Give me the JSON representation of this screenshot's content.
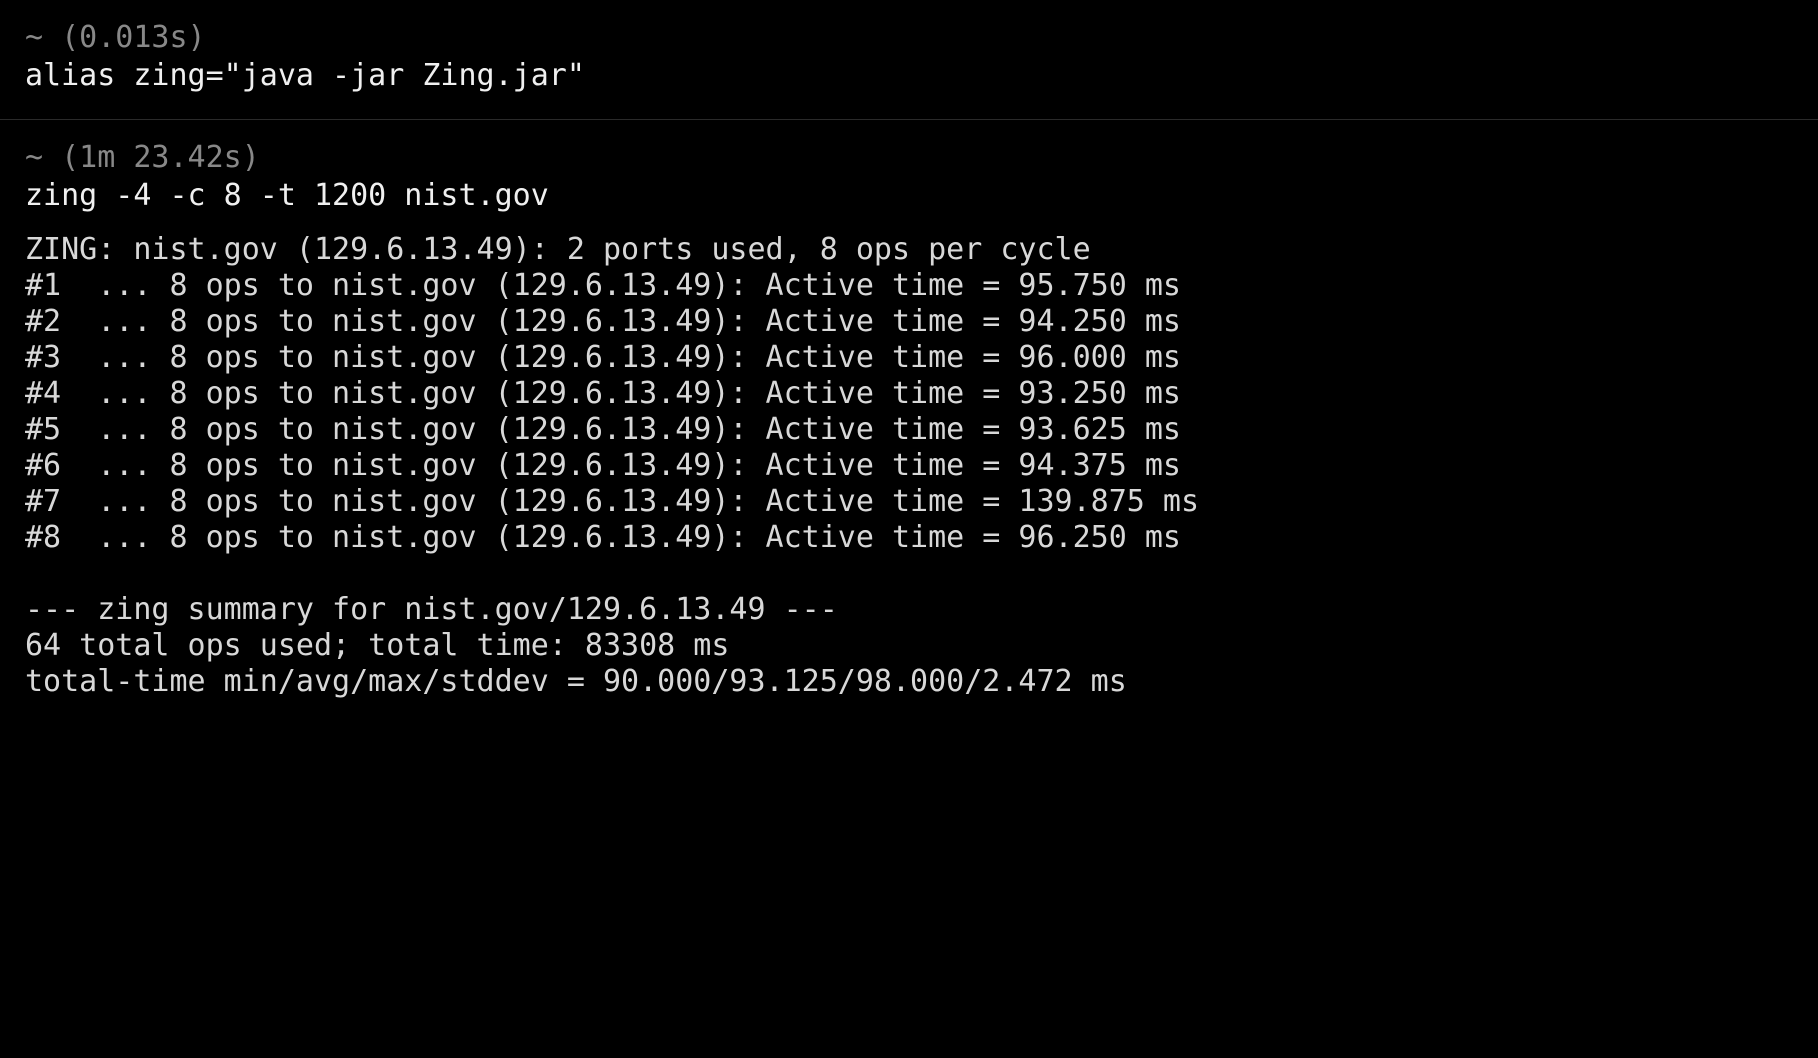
{
  "block1": {
    "prompt": "~ (0.013s)",
    "command": "alias zing=\"java -jar Zing.jar\""
  },
  "block2": {
    "prompt": "~ (1m 23.42s)",
    "command": "zing -4 -c 8 -t 1200 nist.gov",
    "header": "ZING: nist.gov (129.6.13.49): 2 ports used, 8 ops per cycle",
    "lines": [
      "#1  ... 8 ops to nist.gov (129.6.13.49): Active time = 95.750 ms",
      "#2  ... 8 ops to nist.gov (129.6.13.49): Active time = 94.250 ms",
      "#3  ... 8 ops to nist.gov (129.6.13.49): Active time = 96.000 ms",
      "#4  ... 8 ops to nist.gov (129.6.13.49): Active time = 93.250 ms",
      "#5  ... 8 ops to nist.gov (129.6.13.49): Active time = 93.625 ms",
      "#6  ... 8 ops to nist.gov (129.6.13.49): Active time = 94.375 ms",
      "#7  ... 8 ops to nist.gov (129.6.13.49): Active time = 139.875 ms",
      "#8  ... 8 ops to nist.gov (129.6.13.49): Active time = 96.250 ms"
    ],
    "summary1": "--- zing summary for nist.gov/129.6.13.49 ---",
    "summary2": "64 total ops used; total time: 83308 ms",
    "summary3": "total-time min/avg/max/stddev = 90.000/93.125/98.000/2.472 ms"
  }
}
